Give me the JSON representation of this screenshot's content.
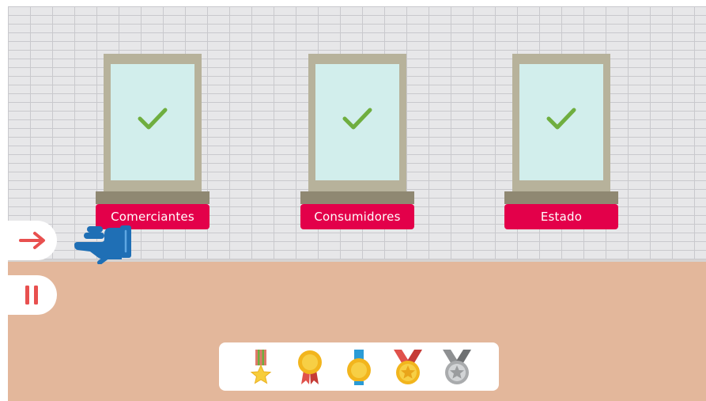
{
  "windows": [
    {
      "label": "Comerciantes",
      "status": "completed",
      "icon": "checkmark-icon"
    },
    {
      "label": "Consumidores",
      "status": "completed",
      "icon": "checkmark-icon"
    },
    {
      "label": "Estado",
      "status": "completed",
      "icon": "checkmark-icon"
    }
  ],
  "controls": {
    "next_icon": "arrow-right-icon",
    "pause_icon": "pause-icon",
    "hint_icon": "pointing-hand-icon"
  },
  "medals": [
    {
      "icon": "star-ribbon-medal-icon"
    },
    {
      "icon": "gold-rosette-medal-icon"
    },
    {
      "icon": "blue-ribbon-gold-medal-icon"
    },
    {
      "icon": "red-ribbon-star-medal-icon"
    },
    {
      "icon": "silver-star-medal-icon"
    }
  ],
  "colors": {
    "label_bg": "#e3004a",
    "check": "#6fae3f",
    "arrow": "#e8504f",
    "hand": "#1f6fb5",
    "floor": "#e3b79b"
  }
}
